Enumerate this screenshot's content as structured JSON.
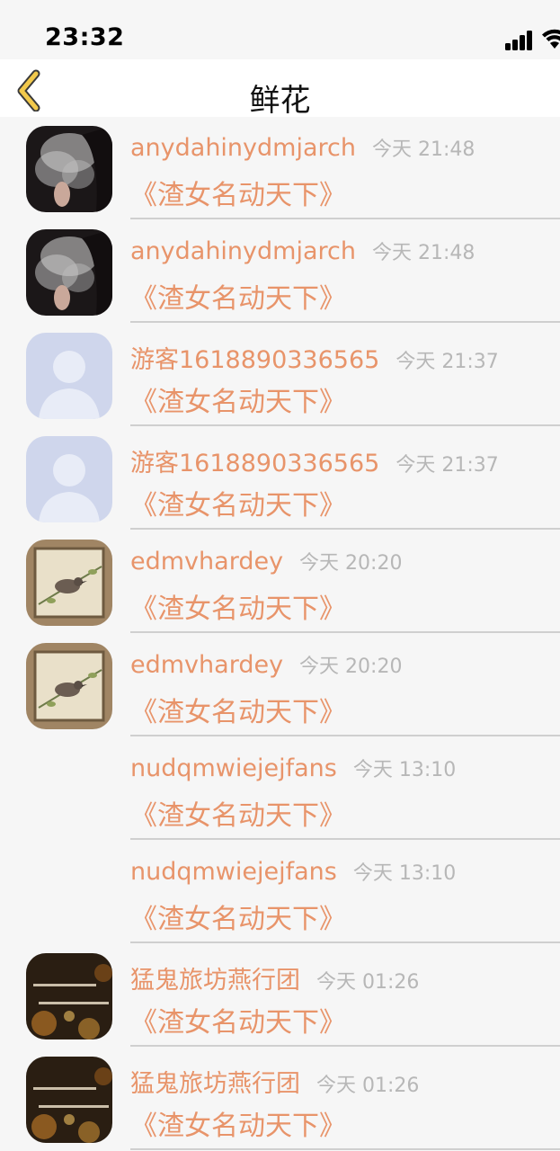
{
  "status_bar": {
    "time": "23:32",
    "signal_icon": "cellular-signal",
    "wifi_icon": "wifi"
  },
  "nav": {
    "title": "鲜花",
    "back_icon": "chevron-left"
  },
  "accent_color": "#e8946a",
  "items": [
    {
      "user": "anydahinydmjarch",
      "time": "今天 21:48",
      "gift": "《渣女名动天下》",
      "avatar": "smoke"
    },
    {
      "user": "anydahinydmjarch",
      "time": "今天 21:48",
      "gift": "《渣女名动天下》",
      "avatar": "smoke"
    },
    {
      "user": "游客1618890336565",
      "time": "今天 21:37",
      "gift": "《渣女名动天下》",
      "avatar": "default"
    },
    {
      "user": "游客1618890336565",
      "time": "今天 21:37",
      "gift": "《渣女名动天下》",
      "avatar": "default"
    },
    {
      "user": "edmvhardey",
      "time": "今天 20:20",
      "gift": "《渣女名动天下》",
      "avatar": "bird"
    },
    {
      "user": "edmvhardey",
      "time": "今天 20:20",
      "gift": "《渣女名动天下》",
      "avatar": "bird"
    },
    {
      "user": "nudqmwiejejfans",
      "time": "今天 13:10",
      "gift": "《渣女名动天下》",
      "avatar": "none"
    },
    {
      "user": "nudqmwiejejfans",
      "time": "今天 13:10",
      "gift": "《渣女名动天下》",
      "avatar": "none"
    },
    {
      "user": "猛鬼旅坊燕行团",
      "time": "今天 01:26",
      "gift": "《渣女名动天下》",
      "avatar": "bokeh"
    },
    {
      "user": "猛鬼旅坊燕行团",
      "time": "今天 01:26",
      "gift": "《渣女名动天下》",
      "avatar": "bokeh"
    }
  ]
}
